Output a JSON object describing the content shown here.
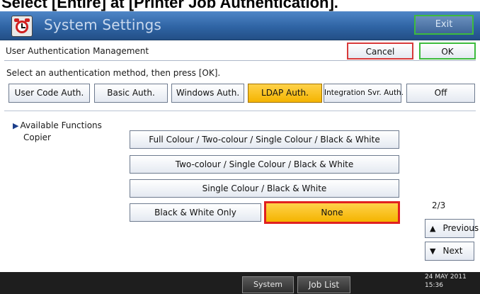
{
  "caption": "Select [Entire] at [Printer Job Authentication].",
  "window": {
    "title": "System Settings",
    "exit_label": "Exit"
  },
  "management": {
    "title": "User Authentication Management",
    "cancel_label": "Cancel",
    "ok_label": "OK"
  },
  "instruction": "Select an authentication method, then press [OK].",
  "auth_methods": [
    {
      "label": "User Code Auth.",
      "selected": false
    },
    {
      "label": "Basic Auth.",
      "selected": false
    },
    {
      "label": "Windows Auth.",
      "selected": false
    },
    {
      "label": "LDAP Auth.",
      "selected": true
    },
    {
      "label": "Integration Svr. Auth.",
      "selected": false
    },
    {
      "label": "Off",
      "selected": false
    }
  ],
  "available_functions": {
    "label": "Available Functions",
    "copier_label": "Copier",
    "options": [
      {
        "label": "Full Colour / Two-colour / Single Colour / Black & White",
        "selected": false
      },
      {
        "label": "Two-colour / Single Colour / Black & White",
        "selected": false
      },
      {
        "label": "Single Colour / Black & White",
        "selected": false
      },
      {
        "label": "Black & White Only",
        "selected": false
      },
      {
        "label": "None",
        "selected": true
      }
    ]
  },
  "pagination": {
    "page": "2/3",
    "previous_label": "Previous",
    "next_label": "Next"
  },
  "statusbar": {
    "system_status_label": "System Status",
    "job_list_label": "Job List",
    "date": "24 MAY  2011",
    "time": "15:36"
  },
  "colors": {
    "title_bar": "#2f64a4",
    "selected_fill": "#f4b400",
    "highlight_border": "#e02020",
    "ok_border": "#3dbb3d",
    "cancel_border": "#d83a3a"
  },
  "icons": {
    "app": "timer-clock-icon",
    "previous": "triangle-up-icon",
    "next": "triangle-down-icon",
    "section": "triangle-right-icon"
  }
}
